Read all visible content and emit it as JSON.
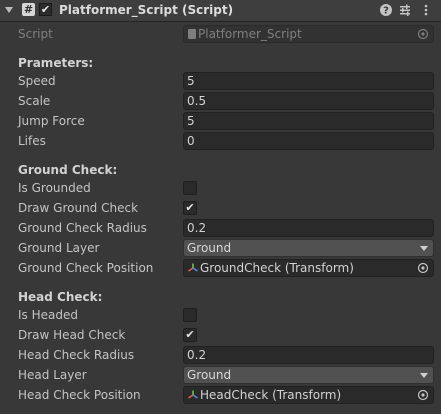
{
  "header": {
    "title": "Platformer_Script (Script)",
    "script_icon_glyph": "#",
    "enabled_check": "✔"
  },
  "script_field": {
    "label": "Script",
    "value": "Platformer_Script"
  },
  "parameters": {
    "title": "Prameters:",
    "speed_label": "Speed",
    "speed_value": "5",
    "scale_label": "Scale",
    "scale_value": "0.5",
    "jump_force_label": "Jump Force",
    "jump_force_value": "5",
    "lifes_label": "Lifes",
    "lifes_value": "0"
  },
  "ground_check": {
    "title": "Ground Check:",
    "is_grounded_label": "Is Grounded",
    "is_grounded": false,
    "draw_label": "Draw Ground Check",
    "draw_checked": true,
    "draw_check_glyph": "✔",
    "radius_label": "Ground Check Radius",
    "radius_value": "0.2",
    "layer_label": "Ground Layer",
    "layer_value": "Ground",
    "position_label": "Ground Check Position",
    "position_value": "GroundCheck (Transform)"
  },
  "head_check": {
    "title": "Head Check:",
    "is_headed_label": "Is Headed",
    "is_headed": false,
    "draw_label": "Draw Head Check",
    "draw_checked": true,
    "draw_check_glyph": "✔",
    "radius_label": "Head Check Radius",
    "radius_value": "0.2",
    "layer_label": "Head Layer",
    "layer_value": "Ground",
    "position_label": "Head Check Position",
    "position_value": "HeadCheck (Transform)"
  },
  "icons": {
    "help": "help-icon",
    "presets": "presets-icon",
    "menu": "kebab-menu-icon",
    "transform": "transform-icon",
    "object_picker": "object-picker-icon"
  },
  "colors": {
    "background": "#383838",
    "header": "#3e3e3e",
    "field": "#2a2a2a",
    "dropdown": "#515151",
    "text": "#c4c4c4"
  }
}
